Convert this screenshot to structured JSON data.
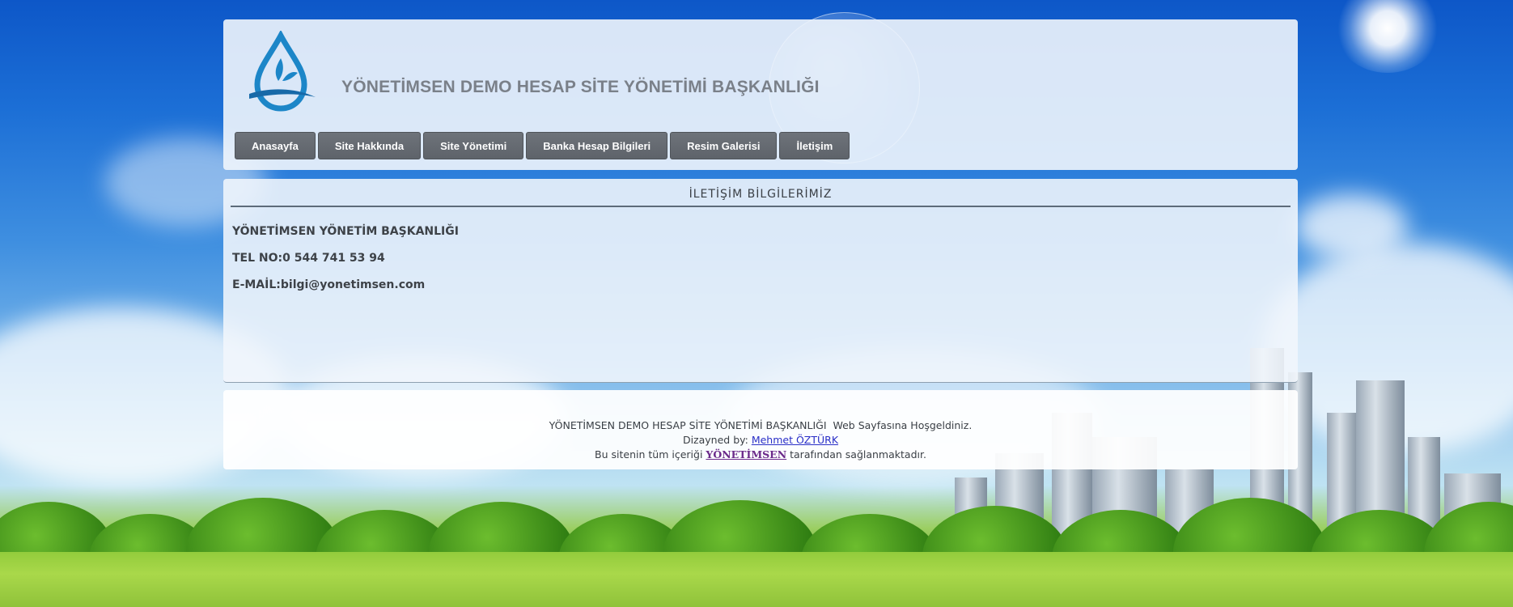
{
  "header": {
    "site_title": "YÖNETİMSEN DEMO HESAP SİTE YÖNETİMİ BAŞKANLIĞI",
    "logo_icon": "water-drop-leaf-logo"
  },
  "nav": {
    "items": [
      {
        "label": "Anasayfa"
      },
      {
        "label": "Site Hakkında"
      },
      {
        "label": "Site Yönetimi"
      },
      {
        "label": "Banka Hesap Bilgileri"
      },
      {
        "label": "Resim Galerisi"
      },
      {
        "label": "İletişim"
      }
    ]
  },
  "content": {
    "title": "İLETİŞİM BİLGİLERİMİZ",
    "lines": [
      "YÖNETİMSEN YÖNETİM BAŞKANLIĞI",
      "TEL NO:0 544 741 53 94",
      "E-MAİL:bilgi@yonetimsen.com"
    ]
  },
  "footer": {
    "welcome_site": "YÖNETİMSEN DEMO HESAP SİTE YÖNETİMİ BAŞKANLIĞI",
    "welcome_suffix": "Web Sayfasına Hoşgeldiniz.",
    "designed_by_label": "Dizayned by:",
    "designer_name": "Mehmet ÖZTÜRK",
    "content_prefix": "Bu sitenin tüm içeriği",
    "content_brand": "YÖNETİMSEN",
    "content_suffix": "tarafından sağlanmaktadır."
  },
  "colors": {
    "nav_button": "#62676e",
    "title_gray": "#7a8089",
    "link_blue": "#2a2fc7",
    "brand_purple": "#6b2a8a"
  }
}
